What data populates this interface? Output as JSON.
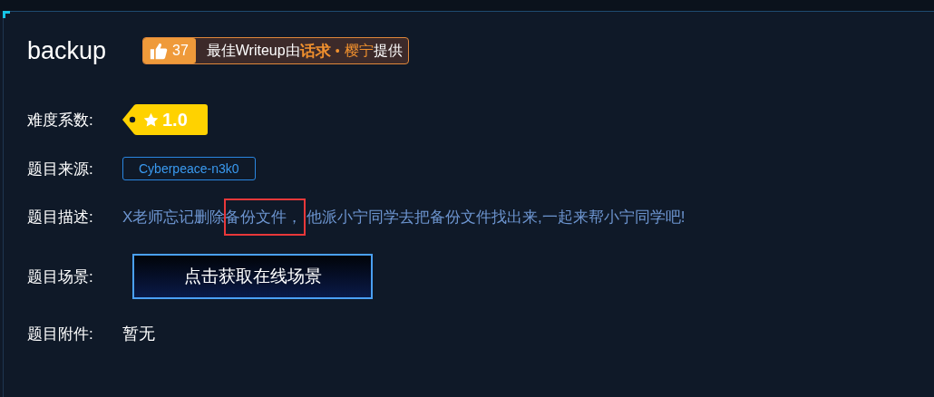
{
  "title": "backup",
  "writeup_badge": {
    "likes": "37",
    "prefix": "最佳Writeup由",
    "author": "话求",
    "separator": "•",
    "coauthor": "樱宁",
    "suffix": "提供"
  },
  "difficulty": {
    "label": "难度系数:",
    "value": "1.0"
  },
  "source": {
    "label": "题目来源:",
    "value": "Cyberpeace-n3k0"
  },
  "description": {
    "label": "题目描述:",
    "before": "X老师忘记删除",
    "highlighted": "备份文件，",
    "after": " 他派小宁同学去把备份文件找出来,一起来帮小宁同学吧!"
  },
  "scene": {
    "label": "题目场景:",
    "button": "点击获取在线场景"
  },
  "attachment": {
    "label": "题目附件:",
    "value": "暂无"
  }
}
